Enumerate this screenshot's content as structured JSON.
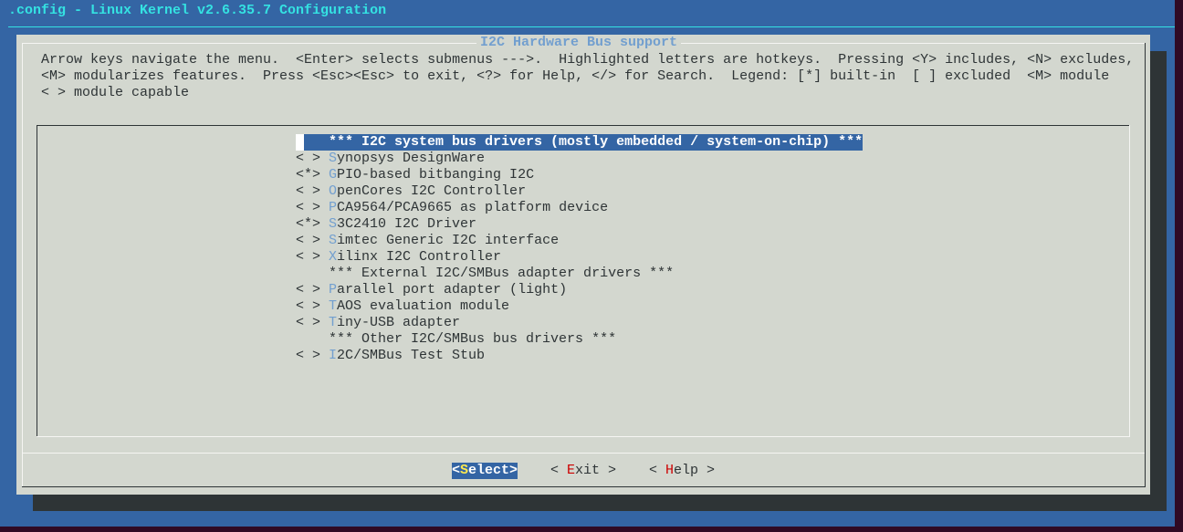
{
  "window_title": ".config - Linux Kernel v2.6.35.7 Configuration",
  "dialog": {
    "title": "I2C Hardware Bus support",
    "help_lines": [
      "Arrow keys navigate the menu.  <Enter> selects submenus --->.  Highlighted letters are hotkeys.  Pressing <Y> includes, <N> excludes,",
      "<M> modularizes features.  Press <Esc><Esc> to exit, <?> for Help, </> for Search.  Legend: [*] built-in  [ ] excluded  <M> module",
      "< > module capable"
    ]
  },
  "menu": {
    "items": [
      {
        "state": "   ",
        "hotkey": "",
        "rest": "*** I2C system bus drivers (mostly embedded / system-on-chip) ***",
        "selected": true
      },
      {
        "state": "< > ",
        "hotkey": "S",
        "rest": "ynopsys DesignWare"
      },
      {
        "state": "<*> ",
        "hotkey": "G",
        "rest": "PIO-based bitbanging I2C"
      },
      {
        "state": "< > ",
        "hotkey": "O",
        "rest": "penCores I2C Controller"
      },
      {
        "state": "< > ",
        "hotkey": "P",
        "rest": "CA9564/PCA9665 as platform device"
      },
      {
        "state": "<*> ",
        "hotkey": "S",
        "rest": "3C2410 I2C Driver"
      },
      {
        "state": "< > ",
        "hotkey": "S",
        "rest": "imtec Generic I2C interface"
      },
      {
        "state": "< > ",
        "hotkey": "X",
        "rest": "ilinx I2C Controller"
      },
      {
        "state": "    ",
        "hotkey": "",
        "rest": "*** External I2C/SMBus adapter drivers ***"
      },
      {
        "state": "< > ",
        "hotkey": "P",
        "rest": "arallel port adapter (light)"
      },
      {
        "state": "< > ",
        "hotkey": "T",
        "rest": "AOS evaluation module"
      },
      {
        "state": "< > ",
        "hotkey": "T",
        "rest": "iny-USB adapter"
      },
      {
        "state": "    ",
        "hotkey": "",
        "rest": "*** Other I2C/SMBus bus drivers ***"
      },
      {
        "state": "< > ",
        "hotkey": "I",
        "rest": "2C/SMBus Test Stub"
      }
    ]
  },
  "buttons": [
    {
      "pre": "<",
      "hotkey": "S",
      "post": "elect>",
      "active": true
    },
    {
      "pre": "< ",
      "hotkey": "E",
      "post": "xit >",
      "active": false
    },
    {
      "pre": "< ",
      "hotkey": "H",
      "post": "elp >",
      "active": false
    }
  ],
  "colors": {
    "terminal_bg": "#3465a4",
    "dialog_bg": "#d3d7cf",
    "hotkey": "#729fcf",
    "title": "#34e2e2"
  }
}
